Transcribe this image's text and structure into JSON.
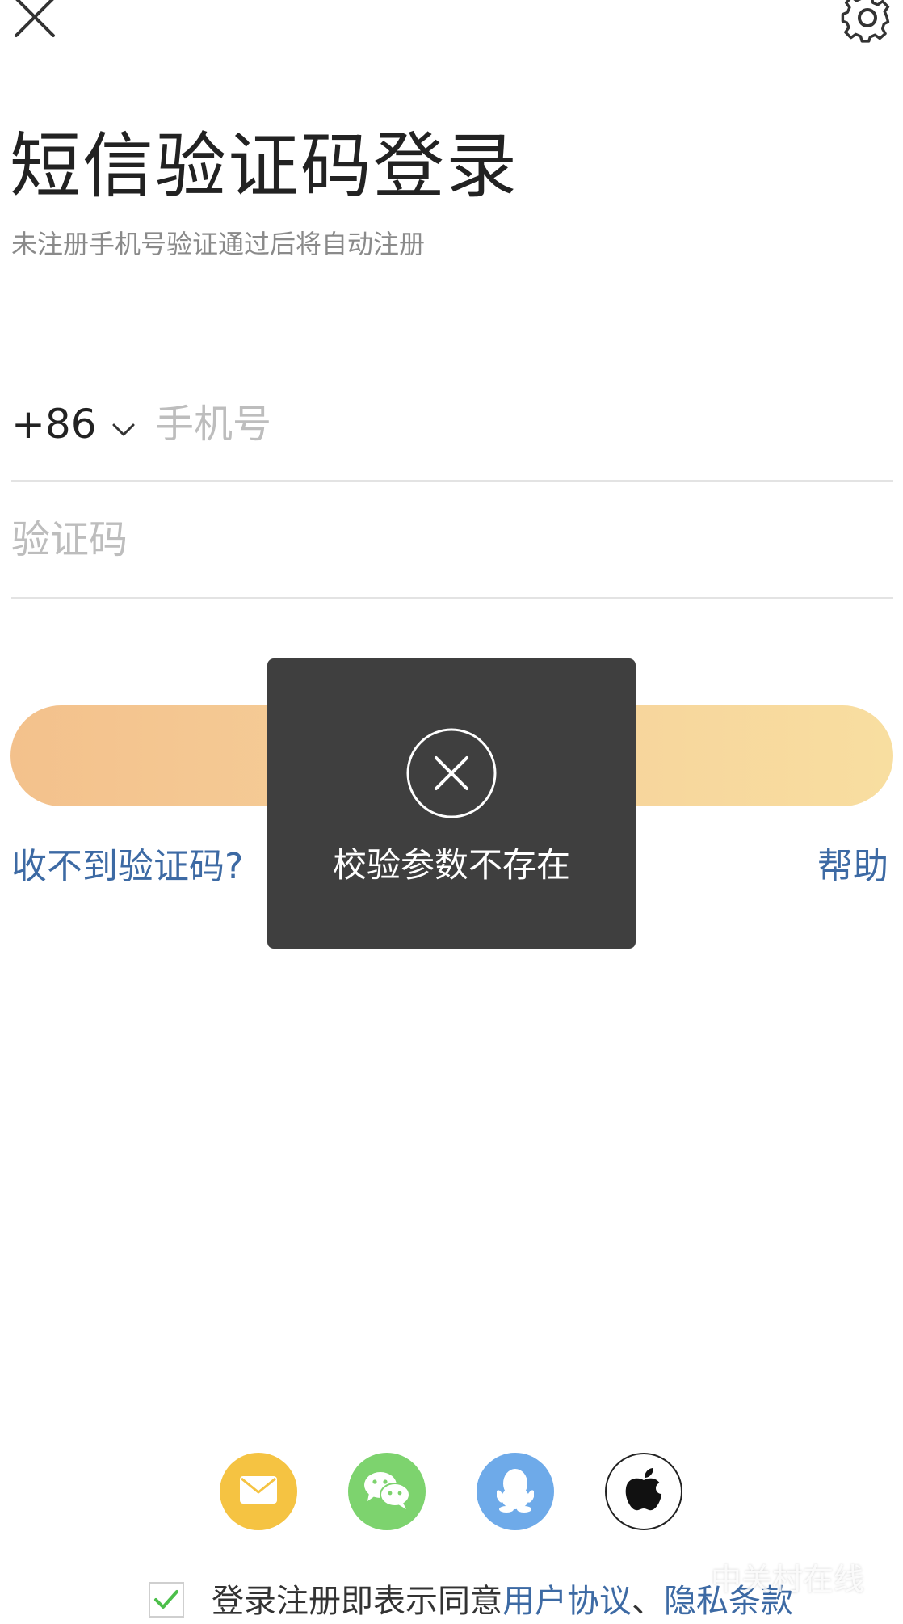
{
  "header": {
    "title": "短信验证码登录",
    "subtitle": "未注册手机号验证通过后将自动注册"
  },
  "form": {
    "country_code": "+86",
    "phone_placeholder": "手机号",
    "code_placeholder": "验证码"
  },
  "links": {
    "no_code": "收不到验证码?",
    "help": "帮助"
  },
  "toast": {
    "message": "校验参数不存在",
    "icon": "close-circle-icon"
  },
  "social_login": [
    {
      "name": "mail",
      "icon": "mail-icon",
      "color": "#f5c342"
    },
    {
      "name": "wechat",
      "icon": "wechat-icon",
      "color": "#7dd36e"
    },
    {
      "name": "qq",
      "icon": "qq-icon",
      "color": "#6eaae9"
    },
    {
      "name": "apple",
      "icon": "apple-icon",
      "color": "#ffffff"
    }
  ],
  "agreement": {
    "checked": true,
    "prefix": "登录注册即表示同意",
    "user_agreement": "用户协议",
    "separator": "、",
    "privacy_policy": "隐私条款"
  },
  "watermark": "中关村在线",
  "colors": {
    "accent_link": "#3d6aa4",
    "button_gradient_start": "#f3c18c",
    "button_gradient_end": "#f8dea0",
    "toast_bg": "#3f3f3f",
    "check_green": "#4cbf4a"
  }
}
